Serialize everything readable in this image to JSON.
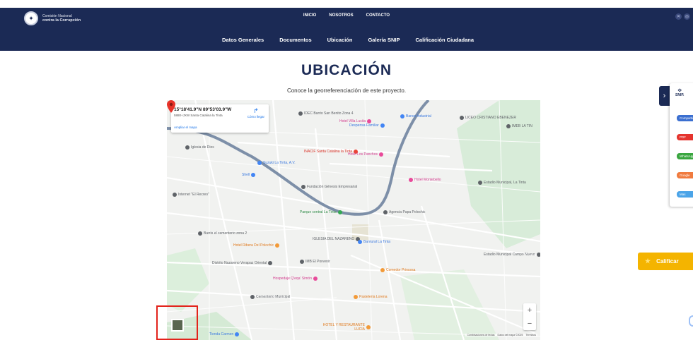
{
  "header": {
    "logo_line1": "Comisión Nacional",
    "logo_line2": "contra la Corrupción",
    "logo_icon": "national-seal-icon",
    "top_nav": [
      "INICIO",
      "NOSOTROS",
      "CONTACTO"
    ],
    "socials": [
      "x-icon",
      "instagram-icon"
    ],
    "sub_nav": [
      "Datos Generales",
      "Documentos",
      "Ubicación",
      "Galería SNIP",
      "Calificación Ciudadana"
    ]
  },
  "main": {
    "title": "UBICACIÓN",
    "subtitle": "Conoce la georreferenciación de este proyecto."
  },
  "map": {
    "coords": "15°18'41.9\"N 89°53'03.9\"W",
    "address": "5880+JXW Santa Catalina la Tinta",
    "directions_label": "Cómo llegar",
    "enlarge_label": "Ampliar el mapa",
    "poi": [
      {
        "label": "Hotel Villa Lucita",
        "color": "p"
      },
      {
        "label": "IDEC Barrio San Benito Zona 4",
        "color": "g"
      },
      {
        "label": "Banco Industrial",
        "color": "b"
      },
      {
        "label": "Despensa Familiar",
        "color": "b"
      },
      {
        "label": "LICEO CRISTIANO EBENEZER",
        "color": "g"
      },
      {
        "label": "IMEB LA TIN",
        "color": "g"
      },
      {
        "label": "Iglesia de Dios",
        "color": "g"
      },
      {
        "label": "INACIF Santa Catalina la Tinta",
        "color": "r"
      },
      {
        "label": "Hotel Los Panchos",
        "color": "p"
      },
      {
        "label": "Suzuki La Tinta, A.V.",
        "color": "b"
      },
      {
        "label": "Shell",
        "color": "b"
      },
      {
        "label": "Fundación Génesis Empresarial",
        "color": "g"
      },
      {
        "label": "Hotel Montebello",
        "color": "p"
      },
      {
        "label": "Estadio Municipal, La Tinta",
        "color": "g"
      },
      {
        "label": "Internet \"El Recreo\"",
        "color": "g"
      },
      {
        "label": "Parque central La Tinta",
        "color": "gr"
      },
      {
        "label": "Agencia Papa Polochic",
        "color": "g"
      },
      {
        "label": "Barrio el cementerio zona 2",
        "color": "g"
      },
      {
        "label": "IGLESIA DEL NAZARENO",
        "color": "g"
      },
      {
        "label": "Banrural La Tinta",
        "color": "b"
      },
      {
        "label": "Hotel Ribera Del Polochic",
        "color": "o"
      },
      {
        "label": "Estadio Municipal Campo Nuevo",
        "color": "g"
      },
      {
        "label": "Distrito Nazareno Verapaz Oriental",
        "color": "g"
      },
      {
        "label": "IMB El Porvenir",
        "color": "g"
      },
      {
        "label": "Comedor Princesa",
        "color": "o"
      },
      {
        "label": "Hospedaje Q'eqa' Simón",
        "color": "p"
      },
      {
        "label": "Cementerio Municipal",
        "color": "g"
      },
      {
        "label": "Pastelería Lorena",
        "color": "o"
      },
      {
        "label": "HOTEL Y RESTAURANTE LUCIA",
        "color": "o"
      },
      {
        "label": "Tienda Carmen",
        "color": "b"
      }
    ],
    "zoom_in": "+",
    "zoom_out": "−",
    "attribution": [
      "Combinaciones de teclas",
      "Datos del mapa ©2025",
      "Términos"
    ]
  },
  "side_panel": {
    "snip_label": "SNIP.",
    "buttons": [
      {
        "label": "Compartir",
        "color": "#3b6fd0"
      },
      {
        "label": "PDF",
        "color": "#e5342e"
      },
      {
        "label": "WhatsApp",
        "color": "#3aa640"
      },
      {
        "label": "Google",
        "color": "#f07b3f"
      },
      {
        "label": "Mas",
        "color": "#4ba4e8"
      }
    ]
  },
  "calificar": {
    "label": "Calificar"
  }
}
